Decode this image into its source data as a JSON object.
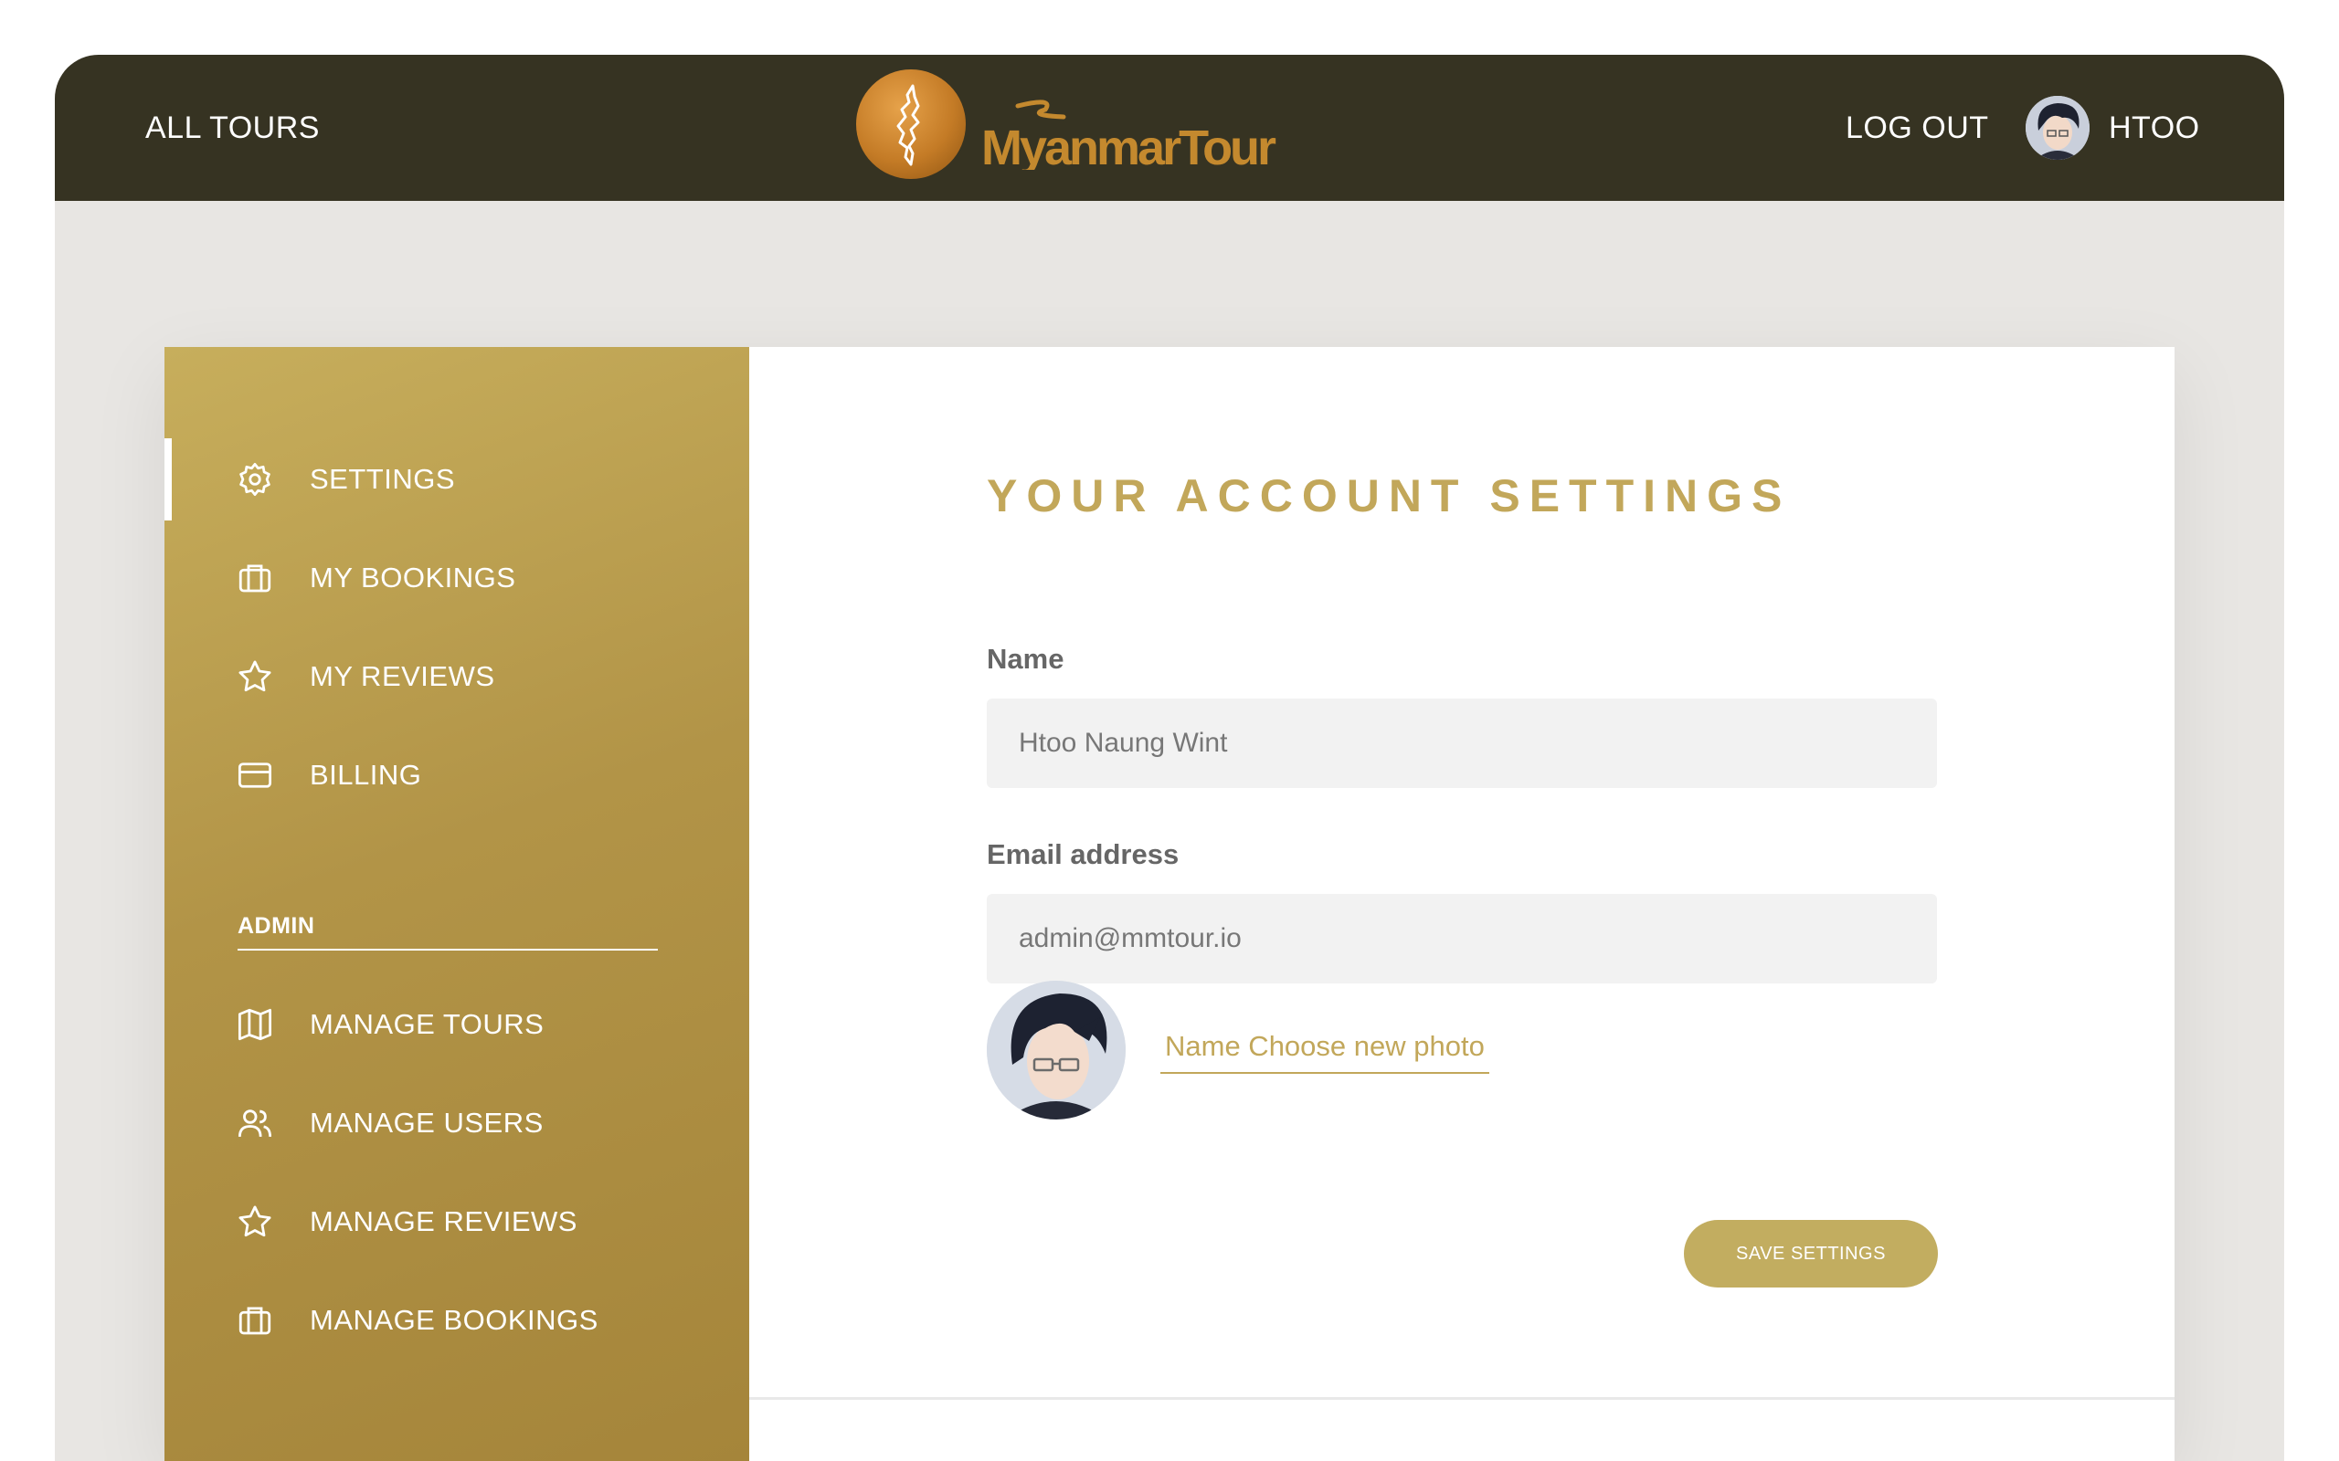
{
  "header": {
    "all_tours": "ALL TOURS",
    "brand": "MyanmarTour",
    "logout": "LOG OUT",
    "user_name": "HTOO"
  },
  "sidebar": {
    "items": [
      {
        "label": "SETTINGS",
        "icon": "gear-icon",
        "active": true
      },
      {
        "label": "MY BOOKINGS",
        "icon": "briefcase-icon"
      },
      {
        "label": "MY REVIEWS",
        "icon": "star-icon"
      },
      {
        "label": "BILLING",
        "icon": "credit-card-icon"
      }
    ],
    "admin_heading": "ADMIN",
    "admin_items": [
      {
        "label": "MANAGE TOURS",
        "icon": "map-icon"
      },
      {
        "label": "MANAGE USERS",
        "icon": "users-icon"
      },
      {
        "label": "MANAGE REVIEWS",
        "icon": "star-icon"
      },
      {
        "label": "MANAGE BOOKINGS",
        "icon": "briefcase-icon"
      }
    ]
  },
  "settings": {
    "title": "YOUR ACCOUNT SETTINGS",
    "name_label": "Name",
    "name_value": "Htoo Naung Wint",
    "email_label": "Email address",
    "email_value": "admin@mmtour.io",
    "photo_link": "Name Choose new photo",
    "save_button": "SAVE SETTINGS"
  },
  "colors": {
    "header_bg": "#363322",
    "accent_gold": "#c2a75a",
    "sidebar_gold": "#b29447",
    "page_bg": "#e8e6e3",
    "input_bg": "#f2f2f2"
  }
}
